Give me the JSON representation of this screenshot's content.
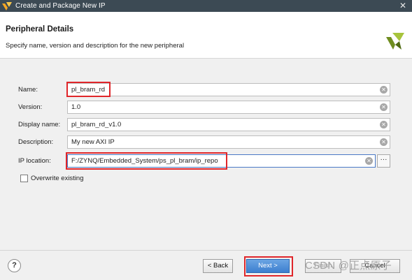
{
  "window": {
    "title": "Create and Package New IP",
    "close_glyph": "✕"
  },
  "header": {
    "title": "Peripheral Details",
    "subtitle": "Specify name, version and description for the new peripheral",
    "logo_icon": "vivado-logo-icon"
  },
  "form": {
    "name": {
      "label": "Name:",
      "value": "pl_bram_rd"
    },
    "version": {
      "label": "Version:",
      "value": "1.0"
    },
    "display_name": {
      "label": "Display name:",
      "value": "pl_bram_rd_v1.0"
    },
    "description": {
      "label": "Description:",
      "value": "My new AXI IP"
    },
    "ip_location": {
      "label": "IP location:",
      "value": "F:/ZYNQ/Embedded_System/ps_pl_bram/ip_repo",
      "browse_label": "···"
    },
    "overwrite": {
      "label": "Overwrite existing",
      "checked": false
    }
  },
  "footer": {
    "help_label": "?",
    "back_label": "< Back",
    "next_label": "Next >",
    "finish_label": "Finish",
    "cancel_label": "Cancel",
    "watermark": "CSDN @正点原子"
  },
  "colors": {
    "titlebar": "#3c4a54",
    "highlight": "#e0262a",
    "next_button": "#3c7fcf"
  }
}
